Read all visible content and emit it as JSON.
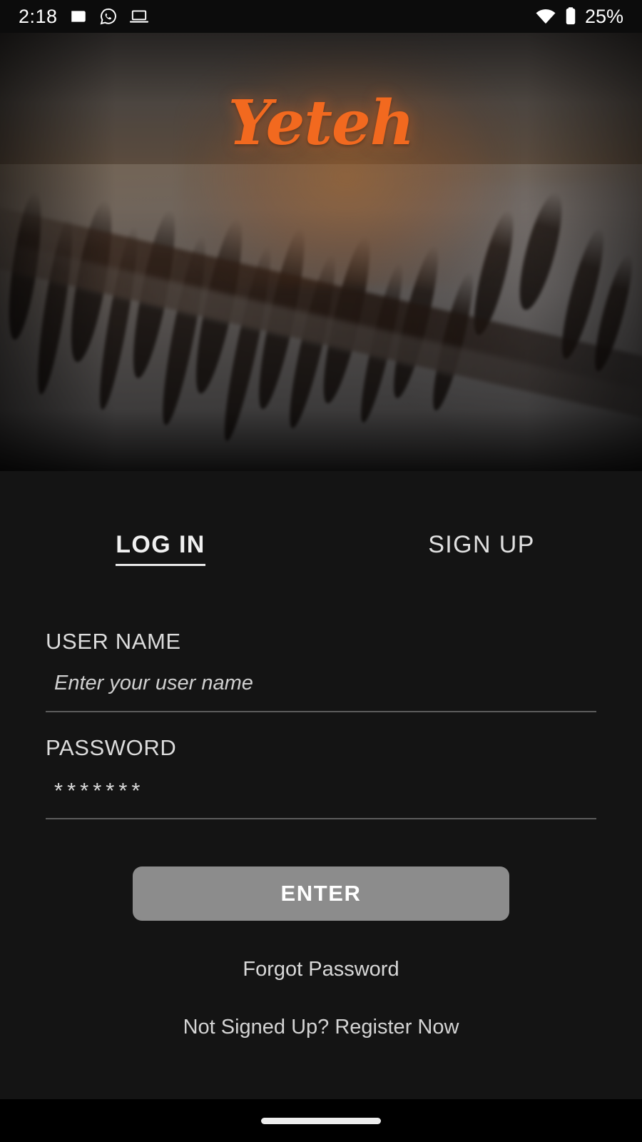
{
  "status_bar": {
    "time": "2:18",
    "battery_percent": "25%",
    "left_icons": [
      "news-icon",
      "whatsapp-icon",
      "laptop-icon"
    ],
    "right_icons": [
      "wifi-icon",
      "battery-icon"
    ]
  },
  "hero": {
    "logo_text": "Yeteh",
    "logo_color": "#F2691F",
    "image_description": "aerial view of snowy forest at sunset"
  },
  "tabs": [
    {
      "label": "LOG IN",
      "active": true
    },
    {
      "label": "SIGN UP",
      "active": false
    }
  ],
  "form": {
    "username": {
      "label": "USER NAME",
      "placeholder": "Enter your user name",
      "value": ""
    },
    "password": {
      "label": "PASSWORD",
      "placeholder": "",
      "value": "*******"
    },
    "submit_label": "ENTER"
  },
  "links": {
    "forgot_password": "Forgot Password",
    "register": "Not Signed Up? Register Now"
  },
  "colors": {
    "accent": "#F2691F",
    "panel_background": "#141414",
    "button_background": "#8C8C8C",
    "text_primary": "#DCDCDC"
  }
}
